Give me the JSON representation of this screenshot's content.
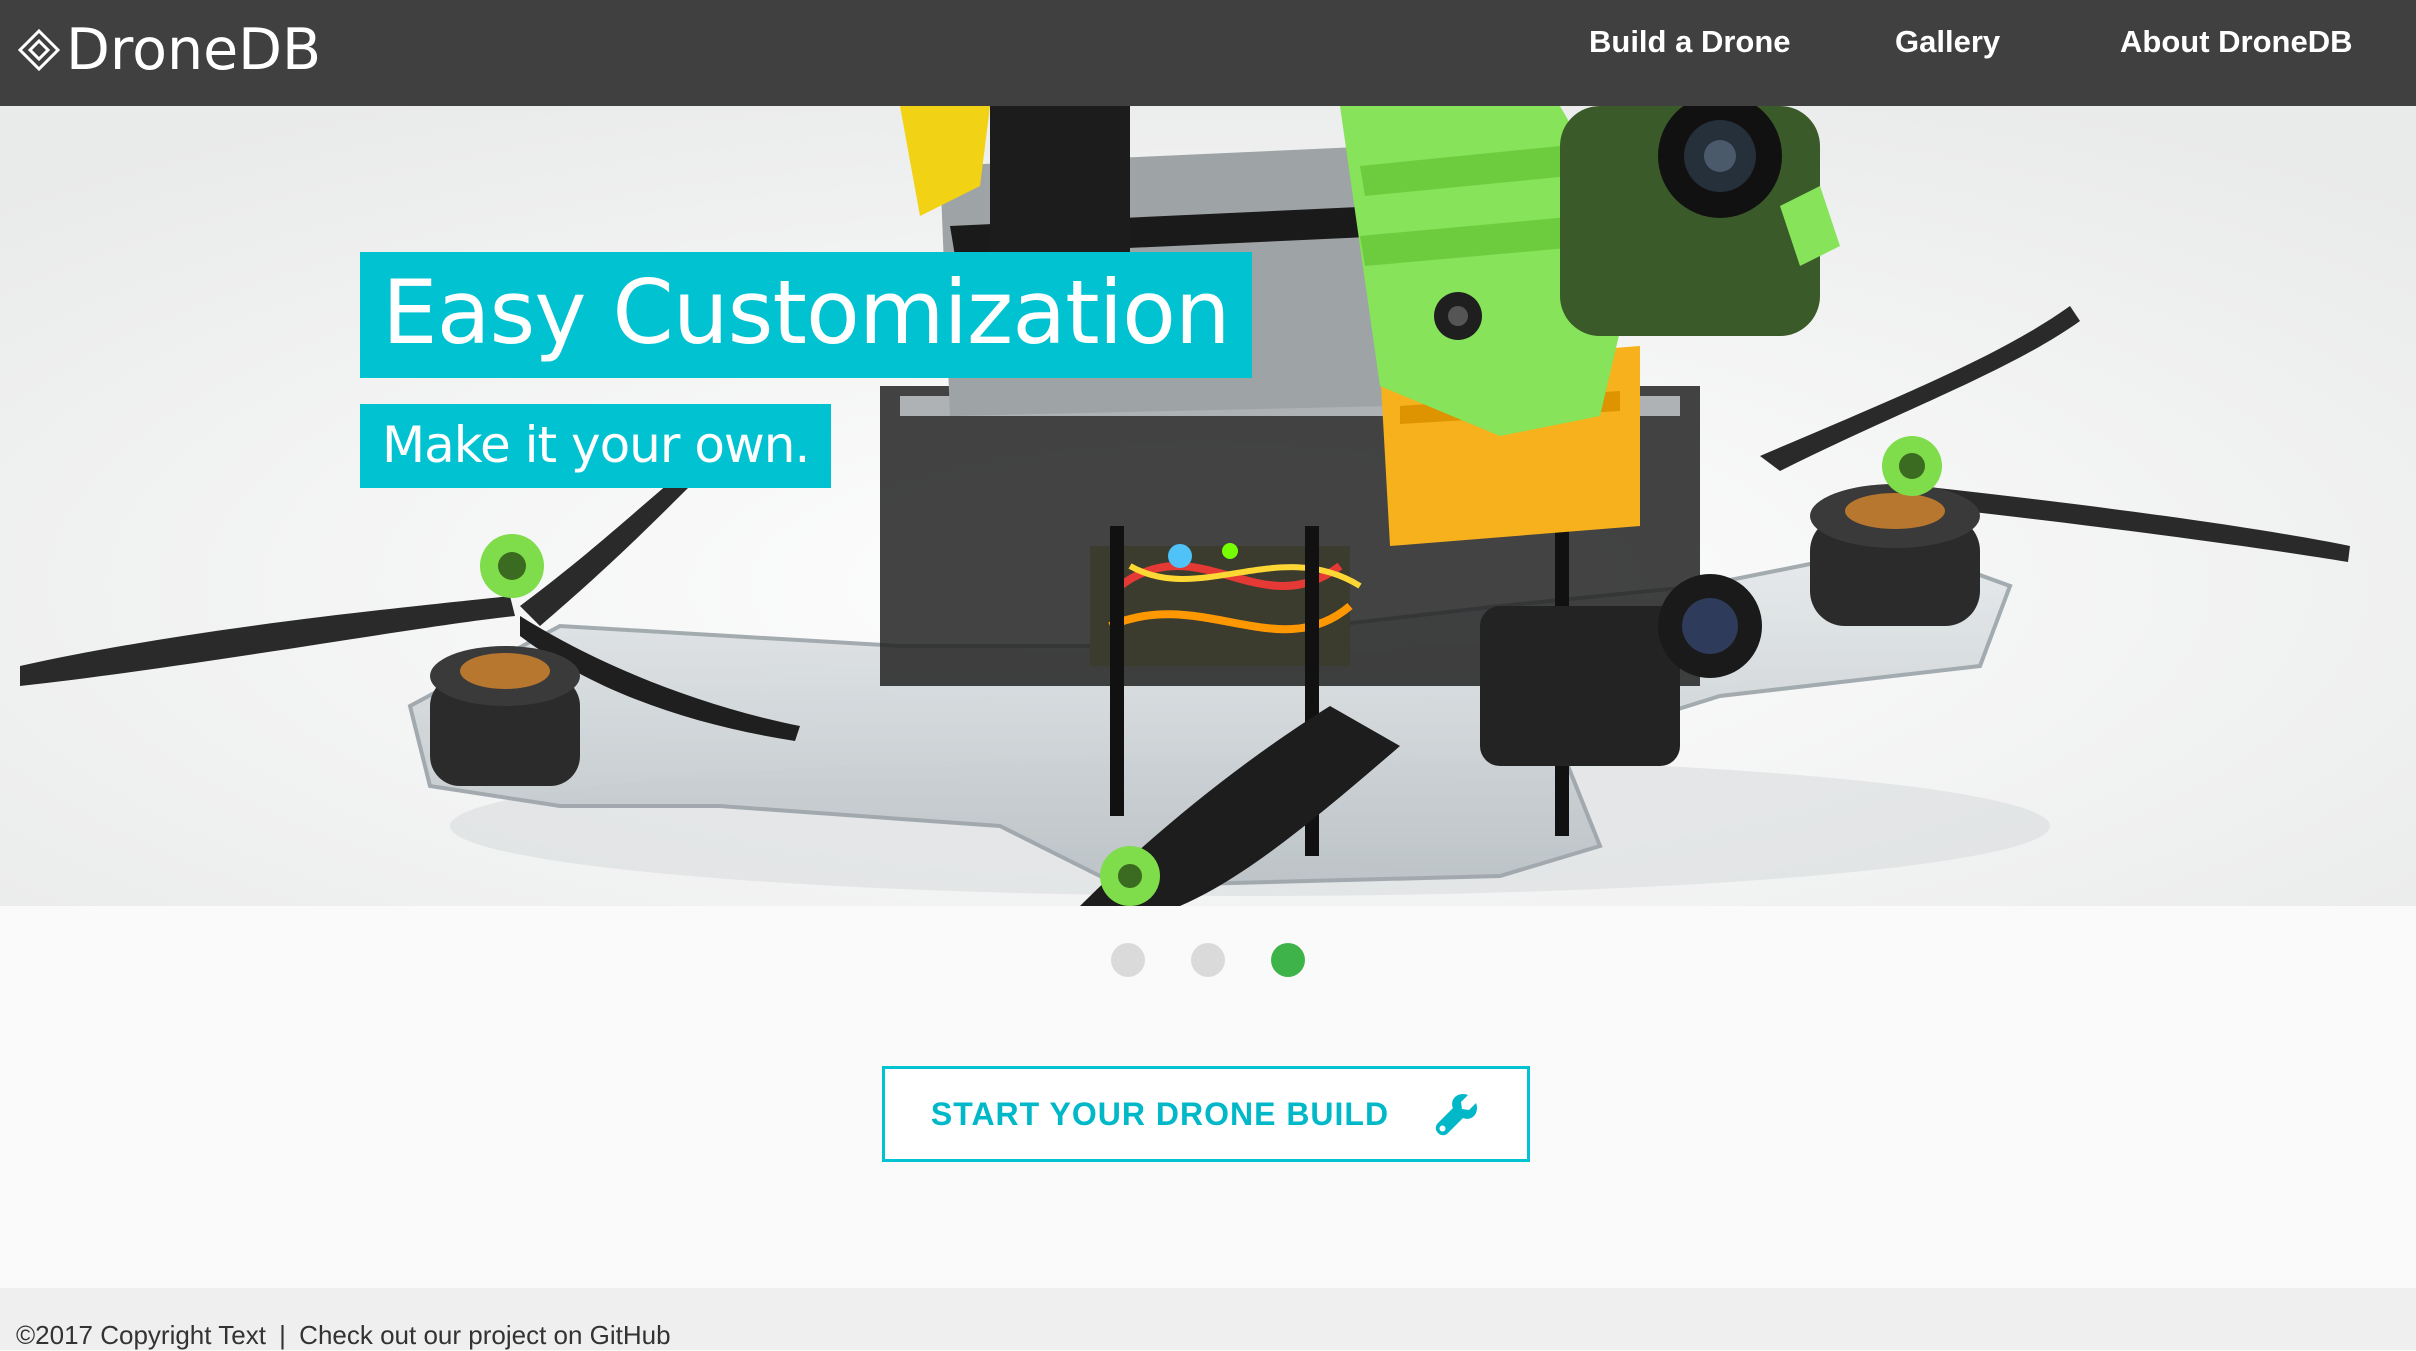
{
  "navbar": {
    "brand": "DroneDB",
    "brand_icon": "diamond-logo-icon",
    "links": [
      {
        "label": "Build a Drone"
      },
      {
        "label": "Gallery"
      },
      {
        "label": "About DroneDB"
      }
    ]
  },
  "hero": {
    "headline": "Easy Customization",
    "subline": "Make it your own.",
    "slides_total": 3,
    "active_slide": 3
  },
  "cta": {
    "label": "START YOUR DRONE BUILD",
    "icon": "wrench-icon"
  },
  "footer": {
    "copyright": "©2017 Copyright Text",
    "separator": "|",
    "link_text": "Check out our project on GitHub"
  },
  "colors": {
    "navbar_bg": "#404040",
    "accent_teal": "#00c2d1",
    "active_dot": "#3db34a",
    "inactive_dot": "#dadada",
    "footer_bg": "#efefef"
  }
}
